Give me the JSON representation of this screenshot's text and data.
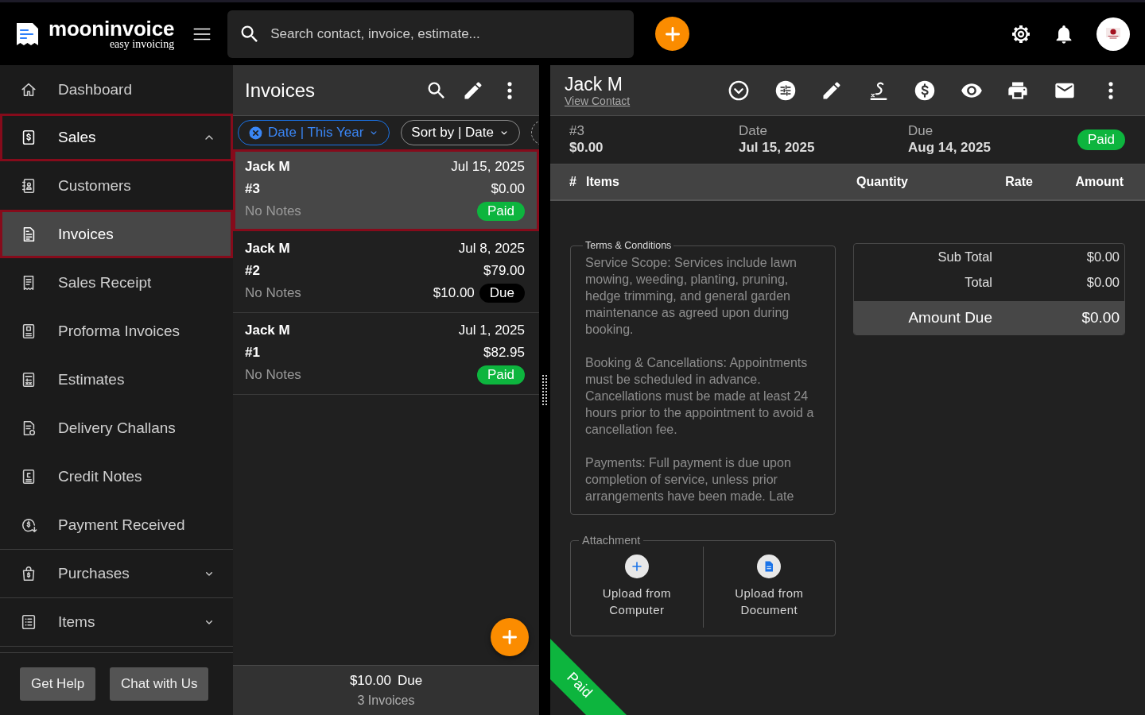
{
  "topbar": {
    "brand": "mooninvoice",
    "tagline": "easy invoicing",
    "search": {
      "placeholder": "Search contact, invoice, estimate..."
    }
  },
  "sidebar": {
    "items": [
      {
        "label": "Dashboard",
        "kind": "link",
        "selected": false,
        "outlined": false
      },
      {
        "label": "Sales",
        "kind": "group",
        "selected": false,
        "outlined": true,
        "expanded": true,
        "children": [
          {
            "label": "Customers",
            "selected": false,
            "outlined": false
          },
          {
            "label": "Invoices",
            "selected": true,
            "outlined": true
          },
          {
            "label": "Sales Receipt",
            "selected": false,
            "outlined": false
          },
          {
            "label": "Proforma Invoices",
            "selected": false,
            "outlined": false
          },
          {
            "label": "Estimates",
            "selected": false,
            "outlined": false
          },
          {
            "label": "Delivery Challans",
            "selected": false,
            "outlined": false
          },
          {
            "label": "Credit Notes",
            "selected": false,
            "outlined": false
          },
          {
            "label": "Payment Received",
            "selected": false,
            "outlined": false
          }
        ]
      },
      {
        "label": "Purchases",
        "kind": "group",
        "selected": false,
        "outlined": false,
        "expanded": false
      },
      {
        "label": "Items",
        "kind": "group",
        "selected": false,
        "outlined": false,
        "expanded": false
      }
    ],
    "buttons": [
      "Get Help",
      "Chat with Us"
    ]
  },
  "list": {
    "title": "Invoices",
    "filters": [
      {
        "label": "Date | This Year",
        "active": true
      },
      {
        "label": "Sort by | Date",
        "active": false
      }
    ],
    "invoices": [
      {
        "customer": "Jack M",
        "date": "Jul 15, 2025",
        "number": "#3",
        "total": "$0.00",
        "notes": "No Notes",
        "status": {
          "label": "Paid",
          "color": "#0db53e"
        },
        "selected": true,
        "outlined": true
      },
      {
        "customer": "Jack M",
        "date": "Jul 8, 2025",
        "number": "#2",
        "total": "$79.00",
        "notes": "No Notes",
        "balance": "$10.00",
        "status": {
          "label": "Due",
          "color": "#000000"
        },
        "selected": false,
        "outlined": false
      },
      {
        "customer": "Jack M",
        "date": "Jul 1, 2025",
        "number": "#1",
        "total": "$82.95",
        "notes": "No Notes",
        "status": {
          "label": "Paid",
          "color": "#0db53e"
        },
        "selected": false,
        "outlined": false
      }
    ],
    "summary": {
      "amount": "$10.00",
      "label": "Due",
      "count": "3 Invoices"
    }
  },
  "detail": {
    "customer": "Jack M",
    "link": "View Contact",
    "fields": [
      {
        "label": "#3",
        "value": "$0.00"
      },
      {
        "label": "Date",
        "value": "Jul 15, 2025"
      },
      {
        "label": "Due",
        "value": "Aug 14, 2025"
      }
    ],
    "status": {
      "label": "Paid",
      "color": "#0db53e"
    },
    "table": {
      "columns": [
        "#",
        "Items",
        "Quantity",
        "Rate",
        "Amount"
      ]
    },
    "terms": {
      "title": "Terms & Conditions",
      "paragraphs": [
        "Service Scope: Services include lawn mowing, weeding, planting, pruning, hedge trimming, and general garden maintenance as agreed upon during booking.",
        "Booking & Cancellations: Appointments must be scheduled in advance. Cancellations must be made at least 24 hours prior to the appointment to avoid a cancellation fee.",
        "Payments: Full payment is due upon completion of service, unless prior arrangements have been made. Late"
      ]
    },
    "totals": [
      {
        "label": "Sub Total",
        "value": "$0.00",
        "kind": "line"
      },
      {
        "label": "Total",
        "value": "$0.00",
        "kind": "line"
      },
      {
        "label": "Amount Due",
        "value": "$0.00",
        "kind": "grand"
      }
    ],
    "attachment": {
      "title": "Attachment",
      "options": [
        "Upload from Computer",
        "Upload from Document"
      ]
    },
    "ribbon": {
      "label": "Paid",
      "color": "#0db53e"
    }
  }
}
